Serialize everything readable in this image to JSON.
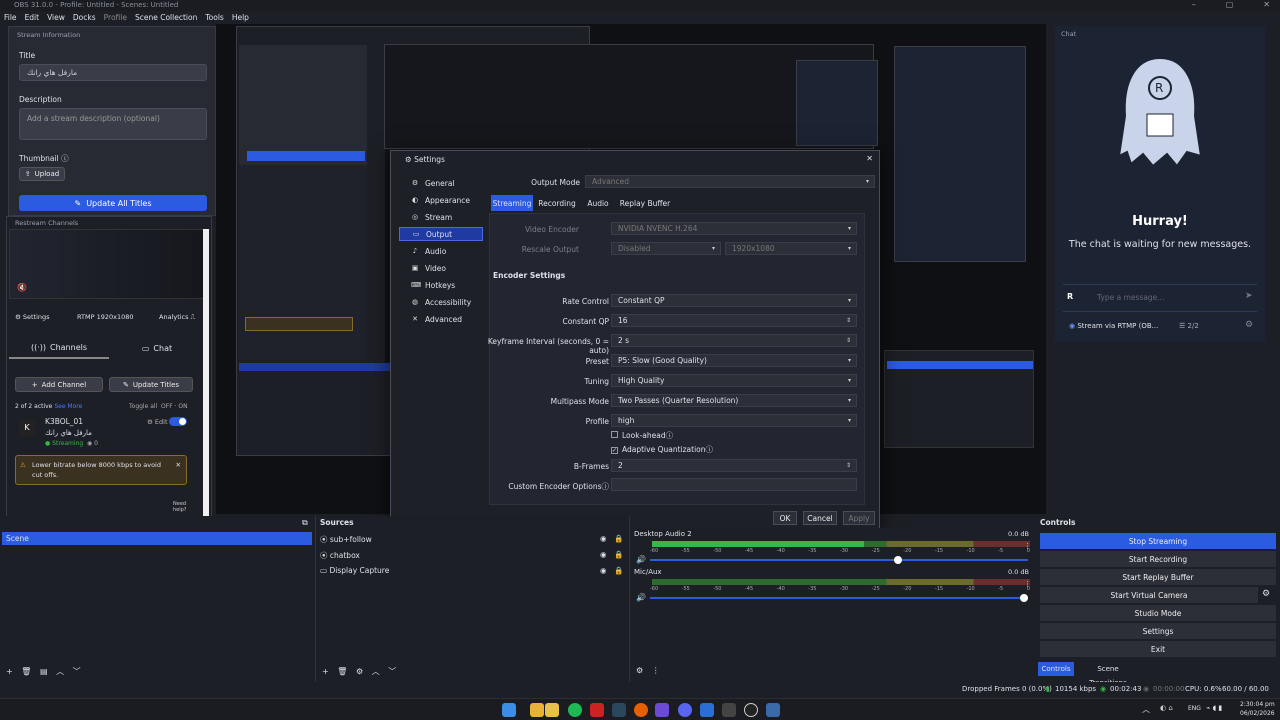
{
  "window": {
    "title": "OBS 31.0.0 - Profile: Untitled - Scenes: Untitled"
  },
  "menu": [
    "File",
    "Edit",
    "View",
    "Docks",
    "Profile",
    "Scene Collection",
    "Tools",
    "Help"
  ],
  "stream_info": {
    "panel_title": "Stream Information",
    "title_label": "Title",
    "title_value": "مارفل هاي رانك",
    "description_label": "Description",
    "description_placeholder": "Add a stream description (optional)",
    "thumbnail_label": "Thumbnail",
    "upload_label": "Upload",
    "update_all_label": "Update All Titles"
  },
  "restream": {
    "panel_title": "Restream Channels",
    "settings_label": "Settings",
    "rtmp_label": "RTMP",
    "resolution": "1920x1080",
    "analytics_label": "Analytics",
    "tab_channels": "Channels",
    "tab_chat": "Chat",
    "add_channel_label": "Add Channel",
    "update_titles_label": "Update Titles",
    "active_count": "2 of 2 active",
    "see_more": "See More",
    "toggle_all": "Toggle all",
    "off": "OFF",
    "on": "ON",
    "channel_name": "K3BOL_01",
    "channel_title": "مارفل هاي رانك",
    "channel_status": "Streaming",
    "viewers": "0",
    "edit_label": "Edit",
    "warning": "Lower bitrate below 8000 kbps to avoid cut offs.",
    "need_help": "Need help?"
  },
  "settings": {
    "title": "Settings",
    "nav": [
      "General",
      "Appearance",
      "Stream",
      "Output",
      "Audio",
      "Video",
      "Hotkeys",
      "Accessibility",
      "Advanced"
    ],
    "nav_icons": [
      "gear-icon",
      "palette-icon",
      "globe-icon",
      "output-icon",
      "speaker-icon",
      "monitor-icon",
      "keyboard-icon",
      "accessibility-icon",
      "wrench-icon"
    ],
    "active_nav": "Output",
    "output_mode_label": "Output Mode",
    "output_mode_value": "Advanced",
    "tabs": [
      "Streaming",
      "Recording",
      "Audio",
      "Replay Buffer"
    ],
    "video_encoder_label": "Video Encoder",
    "video_encoder_value": "NVIDIA NVENC H.264",
    "rescale_label": "Rescale Output",
    "rescale_value": "Disabled",
    "rescale_res": "1920x1080",
    "encoder_settings_header": "Encoder Settings",
    "rows": [
      {
        "label": "Rate Control",
        "value": "Constant QP",
        "type": "dropdown"
      },
      {
        "label": "Constant QP",
        "value": "16",
        "type": "spin"
      },
      {
        "label": "Keyframe Interval (seconds, 0 = auto)",
        "value": "2 s",
        "type": "spin"
      },
      {
        "label": "Preset",
        "value": "P5: Slow (Good Quality)",
        "type": "dropdown"
      },
      {
        "label": "Tuning",
        "value": "High Quality",
        "type": "dropdown"
      },
      {
        "label": "Multipass Mode",
        "value": "Two Passes (Quarter Resolution)",
        "type": "dropdown"
      },
      {
        "label": "Profile",
        "value": "high",
        "type": "dropdown"
      }
    ],
    "lookahead_label": "Look-ahead",
    "adaptive_q_label": "Adaptive Quantization",
    "bframes_label": "B-Frames",
    "bframes_value": "2",
    "custom_opts_label": "Custom Encoder Options",
    "ok_label": "OK",
    "cancel_label": "Cancel",
    "apply_label": "Apply"
  },
  "chat": {
    "panel_title": "Chat",
    "hurray": "Hurray!",
    "message": "The chat is waiting for new messages.",
    "placeholder": "Type a message...",
    "stream_via": "Stream via RTMP (OB...",
    "count": "2/2"
  },
  "scenes": {
    "items": [
      "Scene"
    ]
  },
  "sources": {
    "header": "Sources",
    "items": [
      "sub+follow",
      "chatbox",
      "Display Capture"
    ]
  },
  "audio": [
    {
      "name": "Desktop Audio 2",
      "db": "0.0 dB",
      "level": 0.56
    },
    {
      "name": "Mic/Aux",
      "db": "0.0 dB",
      "level": 0.0
    }
  ],
  "meter_ticks": [
    "-60",
    "-55",
    "-50",
    "-45",
    "-40",
    "-35",
    "-30",
    "-25",
    "-20",
    "-15",
    "-10",
    "-5",
    "0"
  ],
  "controls": {
    "header": "Controls",
    "buttons": [
      "Stop Streaming",
      "Start Recording",
      "Start Replay Buffer",
      "Start Virtual Camera",
      "Studio Mode",
      "Settings",
      "Exit"
    ],
    "tab_controls": "Controls",
    "tab_transitions": "Scene Transitions"
  },
  "statusbar": {
    "dropped": "Dropped Frames 0 (0.0%)",
    "bitrate": "10154 kbps",
    "stream_time": "00:02:43",
    "rec_time": "00:00:00",
    "cpu": "CPU: 0.6%",
    "fps": "60.00 / 60.00 FPS"
  },
  "taskbar": {
    "lang": "ENG",
    "time": "2:30:04 pm",
    "date": "06/02/2026"
  },
  "colors": {
    "accent": "#2b5be0",
    "background": "#1d1f26",
    "panel": "#272a33"
  }
}
